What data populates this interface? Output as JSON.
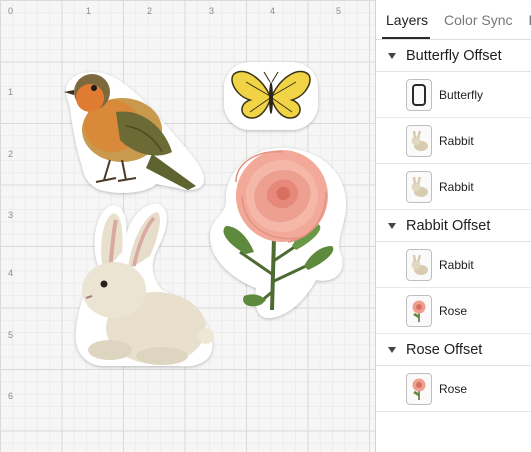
{
  "rulers": {
    "horizontal": [
      "0",
      "1",
      "2",
      "3",
      "4",
      "5"
    ],
    "vertical": [
      "1",
      "2",
      "3",
      "4",
      "5",
      "6"
    ]
  },
  "stickers": [
    {
      "name": "bird",
      "icon": "bird-icon"
    },
    {
      "name": "butterfly",
      "icon": "butterfly-icon"
    },
    {
      "name": "rabbit",
      "icon": "rabbit-icon"
    },
    {
      "name": "rose",
      "icon": "rose-icon"
    }
  ],
  "panel": {
    "tabs": [
      {
        "label": "Layers",
        "active": true
      },
      {
        "label": "Color Sync",
        "active": false
      },
      {
        "label": "F",
        "active": false
      }
    ],
    "groups": [
      {
        "title": "Butterfly Offset",
        "layers": [
          {
            "label": "Butterfly",
            "thumb": "offset-shape-icon"
          },
          {
            "label": "Rabbit",
            "thumb": "rabbit-icon"
          },
          {
            "label": "Rabbit",
            "thumb": "rabbit-icon"
          }
        ]
      },
      {
        "title": "Rabbit Offset",
        "layers": [
          {
            "label": "Rabbit",
            "thumb": "rabbit-icon"
          },
          {
            "label": "Rose",
            "thumb": "rose-icon"
          }
        ]
      },
      {
        "title": "Rose Offset",
        "layers": [
          {
            "label": "Rose",
            "thumb": "rose-icon"
          }
        ]
      }
    ]
  }
}
